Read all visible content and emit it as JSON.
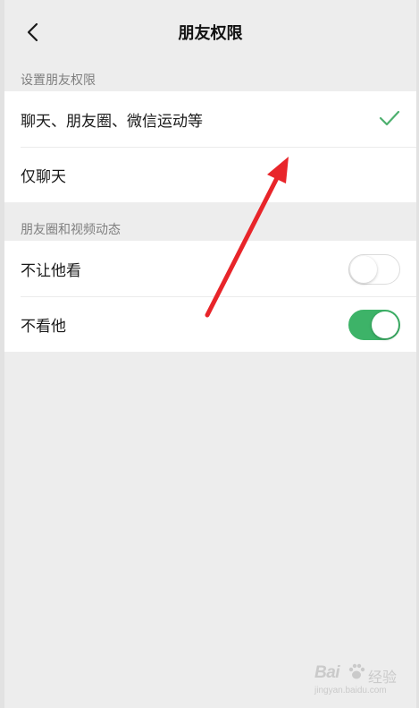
{
  "header": {
    "title": "朋友权限"
  },
  "permission_section": {
    "header": "设置朋友权限",
    "options": [
      {
        "label": "聊天、朋友圈、微信运动等",
        "selected": true
      },
      {
        "label": "仅聊天",
        "selected": false
      }
    ]
  },
  "moments_section": {
    "header": "朋友圈和视频动态",
    "toggles": [
      {
        "label": "不让他看",
        "on": false
      },
      {
        "label": "不看他",
        "on": true
      }
    ]
  },
  "colors": {
    "accent_green": "#3db368",
    "check_green": "#4eb06f",
    "annotation_red": "#e8252a",
    "background": "#ededed"
  },
  "icons": [
    "chevron-left-icon",
    "check-icon"
  ],
  "watermark": {
    "brand": "Bai",
    "suffix": "经验",
    "url": "jingyan.baidu.com"
  }
}
